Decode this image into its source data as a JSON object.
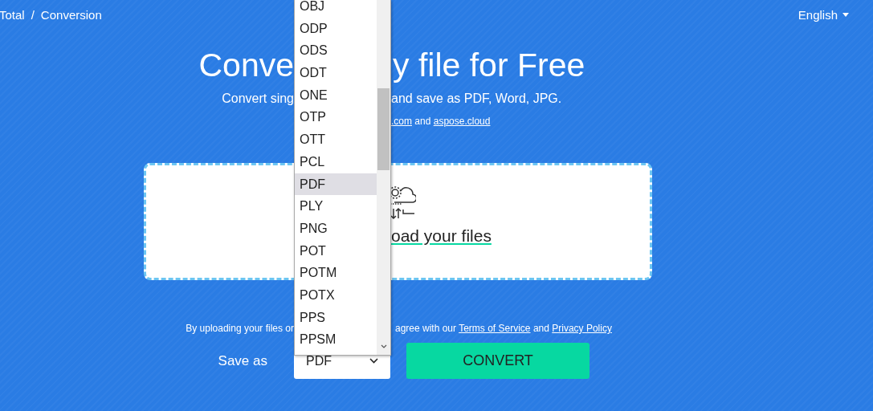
{
  "breadcrumb": {
    "items": [
      {
        "label": "Total"
      },
      {
        "label": "Conversion"
      }
    ],
    "separator": "/"
  },
  "language": {
    "label": "English"
  },
  "title": {
    "left": "Conve",
    "right": "y file for Free"
  },
  "subtitle": {
    "left": "Convert sing",
    "right": "and save as PDF, Word, JPG."
  },
  "powered_by": {
    "link_1": ".com",
    "middle": "and",
    "link_2": "aspose.cloud"
  },
  "upload": {
    "label": "oad your files"
  },
  "consent": {
    "left": "By uploading your files or",
    "right": "agree with our",
    "terms": "Terms of Service",
    "and": "and",
    "privacy": "Privacy Policy"
  },
  "save_as": {
    "label": "Save as",
    "value": "PDF"
  },
  "format_list": {
    "items": [
      {
        "label": "OBJ",
        "selected": false
      },
      {
        "label": "ODP",
        "selected": false
      },
      {
        "label": "ODS",
        "selected": false
      },
      {
        "label": "ODT",
        "selected": false
      },
      {
        "label": "ONE",
        "selected": false
      },
      {
        "label": "OTP",
        "selected": false
      },
      {
        "label": "OTT",
        "selected": false
      },
      {
        "label": "PCL",
        "selected": false
      },
      {
        "label": "PDF",
        "selected": true
      },
      {
        "label": "PLY",
        "selected": false
      },
      {
        "label": "PNG",
        "selected": false
      },
      {
        "label": "POT",
        "selected": false
      },
      {
        "label": "POTM",
        "selected": false
      },
      {
        "label": "POTX",
        "selected": false
      },
      {
        "label": "PPS",
        "selected": false
      },
      {
        "label": "PPSM",
        "selected": false
      }
    ]
  },
  "convert_button": {
    "label": "CONVERT"
  }
}
